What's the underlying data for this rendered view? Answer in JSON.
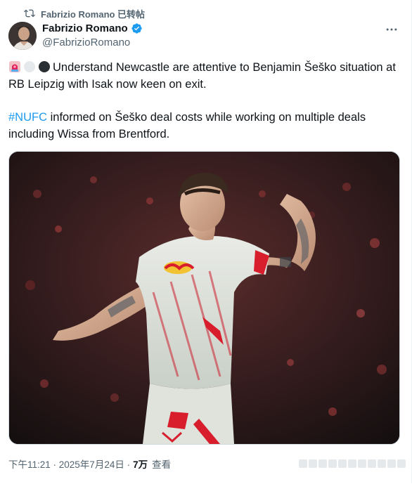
{
  "repost": {
    "icon": "repost-icon",
    "label": "Fabrizio Romano 已转帖"
  },
  "author": {
    "name": "Fabrizio Romano",
    "handle": "@FabrizioRomano",
    "verified": true,
    "verified_color": "#1d9bf0"
  },
  "tweet": {
    "emojis": [
      "siren-emoji",
      "white-circle-emoji",
      "black-circle-emoji"
    ],
    "line1": "Understand Newcastle are attentive to Benjamin Šeško situation at RB Leipzig with Isak now keen on exit.",
    "hashtag": "#NUFC",
    "line2_rest": " informed on Šeško deal costs while working on multiple deals including Wissa from Brentford."
  },
  "footer": {
    "timestamp": "下午11:21 · 2025年7月24日 · ",
    "views_count": "7万",
    "views_label": "查看"
  },
  "colors": {
    "link": "#1d9bf0",
    "secondary_text": "#536471",
    "primary_text": "#0f1419"
  }
}
